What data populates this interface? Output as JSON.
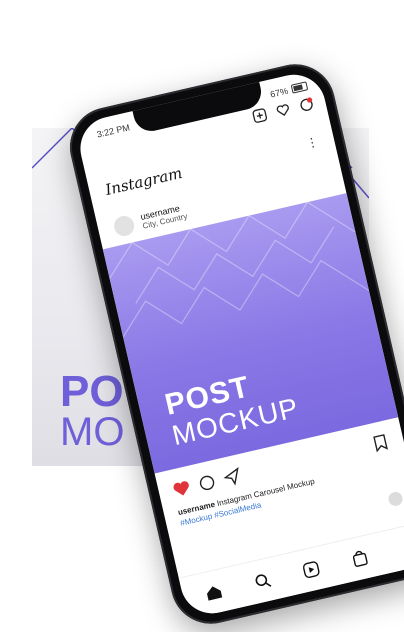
{
  "background_card": {
    "word1": "PO",
    "word2": "MO"
  },
  "status_bar": {
    "time": "3:22 PM",
    "battery_percent": "67%"
  },
  "app": {
    "logo": "Instagram",
    "more_icon": "more-vertical-icon"
  },
  "post": {
    "username": "username",
    "location": "City, Country",
    "image_title_line1": "POST",
    "image_title_line2": "MOCKUP",
    "caption_user": "username",
    "caption_text": "Instagram Carousel Mockup",
    "hashtags": "#Mockup #SocialMedia"
  },
  "icons": {
    "add": "add-post-icon",
    "heart": "heart-icon",
    "messenger": "messenger-icon",
    "like": "liked-heart-icon",
    "comment": "comment-icon",
    "share": "share-icon",
    "save": "bookmark-icon",
    "home": "home-icon",
    "search": "search-icon",
    "reels": "reels-icon",
    "shop": "shop-icon"
  },
  "colors": {
    "accent_purple": "#8a78e6",
    "like_red": "#e0333c",
    "hashtag_blue": "#3a7bd5"
  }
}
